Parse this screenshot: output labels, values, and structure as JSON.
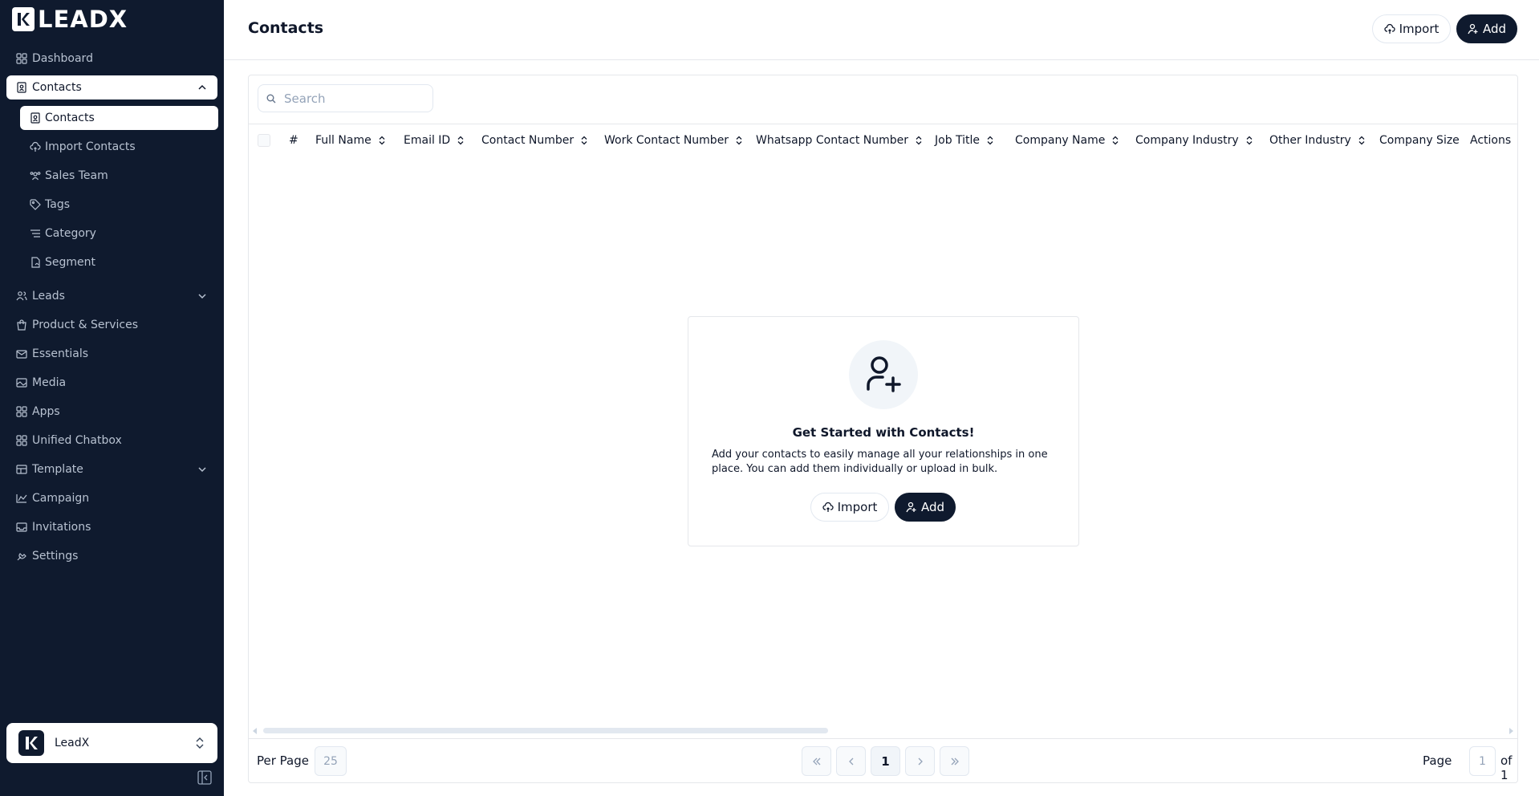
{
  "brand": {
    "name": "LEADX"
  },
  "sidebar": {
    "items": [
      {
        "label": "Dashboard",
        "icon": "dashboard-icon"
      },
      {
        "label": "Contacts",
        "icon": "contacts-icon",
        "expanded": true
      },
      {
        "label": "Leads",
        "icon": "leads-icon"
      },
      {
        "label": "Product & Services",
        "icon": "shopping-bag-icon"
      },
      {
        "label": "Essentials",
        "icon": "mail-icon"
      },
      {
        "label": "Media",
        "icon": "media-icon"
      },
      {
        "label": "Apps",
        "icon": "apps-icon"
      },
      {
        "label": "Unified Chatbox",
        "icon": "chatbox-icon"
      },
      {
        "label": "Template",
        "icon": "template-icon"
      },
      {
        "label": "Campaign",
        "icon": "campaign-icon"
      },
      {
        "label": "Invitations",
        "icon": "inbox-icon"
      },
      {
        "label": "Settings",
        "icon": "settings-icon"
      }
    ],
    "contacts_sub": [
      {
        "label": "Contacts",
        "icon": "contacts-icon"
      },
      {
        "label": "Import Contacts",
        "icon": "cloud-upload-icon"
      },
      {
        "label": "Sales Team",
        "icon": "team-icon"
      },
      {
        "label": "Tags",
        "icon": "tag-icon"
      },
      {
        "label": "Category",
        "icon": "list-icon"
      },
      {
        "label": "Segment",
        "icon": "segment-icon"
      }
    ],
    "org": {
      "name": "LeadX"
    }
  },
  "header": {
    "title": "Contacts",
    "import_label": "Import",
    "add_label": "Add"
  },
  "search": {
    "placeholder": "Search"
  },
  "table": {
    "columns": [
      "#",
      "Full Name",
      "Email ID",
      "Contact Number",
      "Work Contact Number",
      "Whatsapp Contact Number",
      "Job Title",
      "Company Name",
      "Company Industry",
      "Other Industry",
      "Company Size",
      "Actions"
    ]
  },
  "empty_state": {
    "title": "Get Started with Contacts!",
    "description": "Add your contacts to easily manage all your relationships in one place. You can add them individually or upload in bulk.",
    "import_label": "Import",
    "add_label": "Add"
  },
  "pagination": {
    "per_page_label": "Per Page",
    "per_page_value": "25",
    "current_page": "1",
    "page_label": "Page",
    "page_value": "1",
    "of_label": "of 1"
  },
  "colors": {
    "sidebar_bg": "#0f1a2e",
    "accent_dark": "#0f1a2e"
  }
}
